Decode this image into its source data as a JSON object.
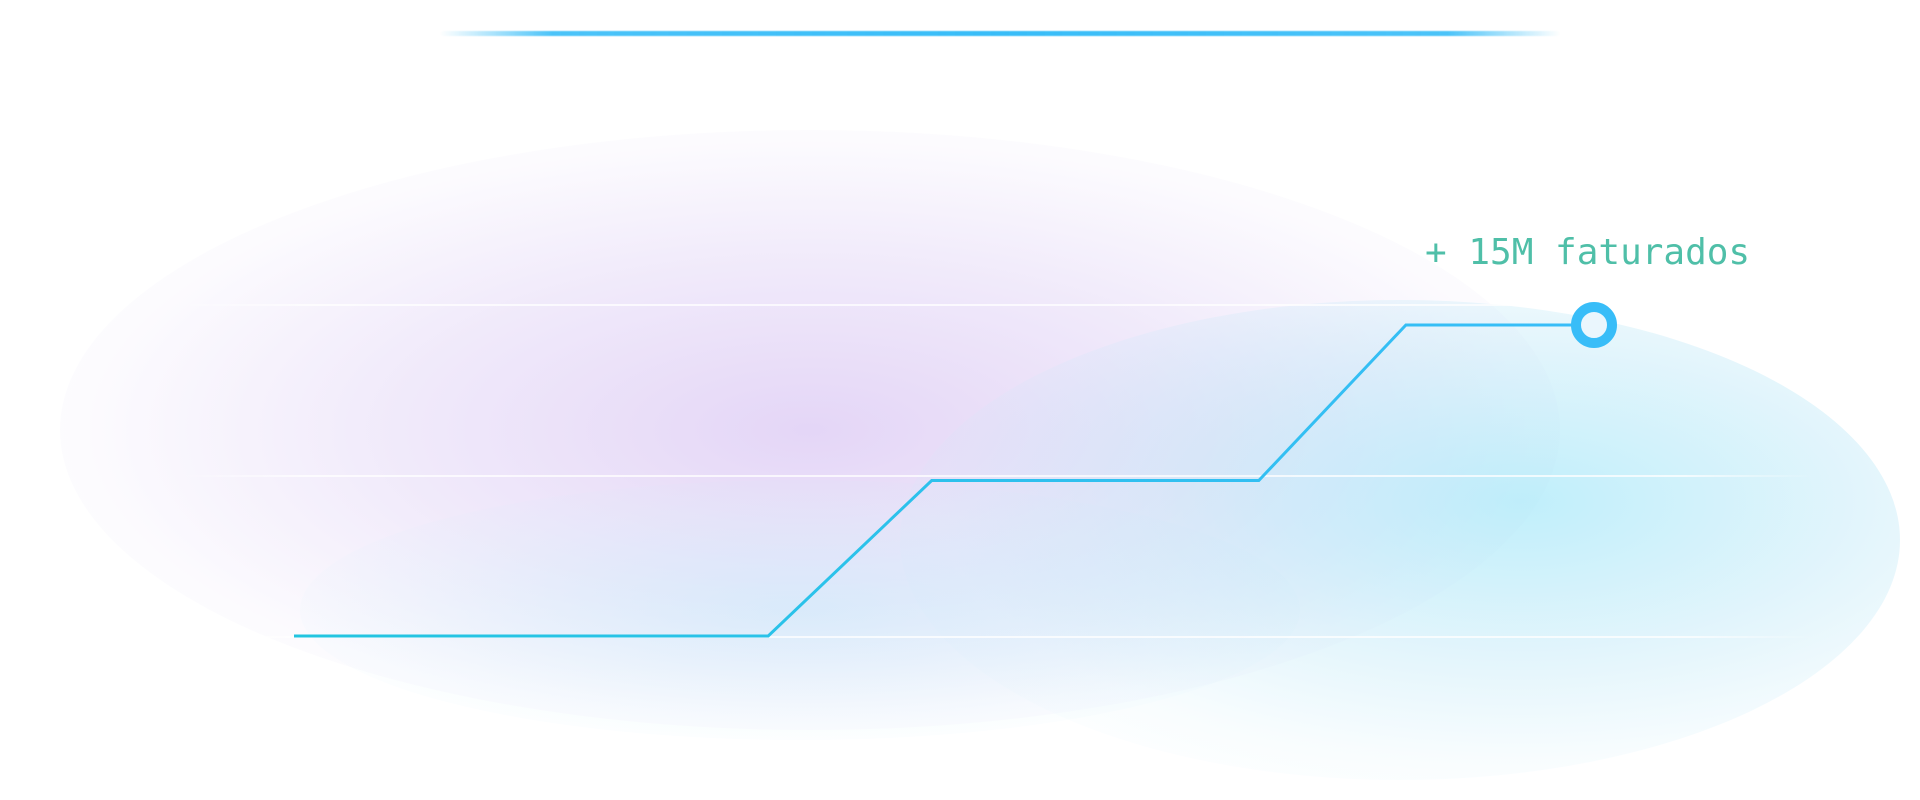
{
  "chart_data": {
    "type": "line",
    "title": "",
    "xlabel": "",
    "ylabel": "",
    "grid": true,
    "line_shape": "stepped-ramp",
    "series": [
      {
        "points": [
          {
            "x": 0,
            "y": 0
          },
          {
            "x": 2.9,
            "y": 0
          },
          {
            "x": 3.9,
            "y": 1
          },
          {
            "x": 5.9,
            "y": 1
          },
          {
            "x": 6.8,
            "y": 2
          },
          {
            "x": 7.95,
            "y": 2
          }
        ],
        "color": "#38bdf8"
      }
    ],
    "xlim": [
      0,
      7.95
    ],
    "ylim": [
      0,
      2
    ],
    "end_marker": "ring",
    "annotations": [
      {
        "text": "+ 15M faturados",
        "anchor": "end-point",
        "color": "#4fbfa8"
      }
    ]
  },
  "colors": {
    "line": "#38bdf8",
    "line_start": "#22c5e0",
    "accent_bar": "#38bdf8",
    "annotation": "#4fbfa8",
    "glow_purple": "#d9c8f2",
    "glow_cyan": "#b8ecf8"
  }
}
